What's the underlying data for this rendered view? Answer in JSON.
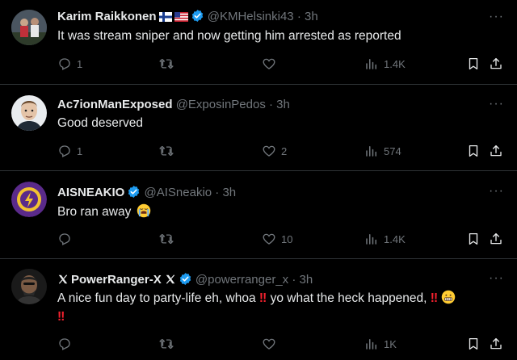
{
  "colors": {
    "background": "#000000",
    "text": "#e7e9ea",
    "muted": "#71767b",
    "verified": "#1d9bf0",
    "divider": "#2f3336"
  },
  "tweets": [
    {
      "name": "Karim Raikkonen",
      "flags": [
        "Finland flag",
        "USA flag"
      ],
      "verified": true,
      "handle": "@KMHelsinki43",
      "time": "3h",
      "text": "It was stream sniper and now getting him arrested as reported",
      "replies": "1",
      "retweets": "",
      "likes": "",
      "views": "1.4K",
      "more": "···"
    },
    {
      "name": "Ac7ionManExposed",
      "verified": false,
      "handle": "@ExposinPedos",
      "time": "3h",
      "text": "Good deserved",
      "replies": "1",
      "retweets": "",
      "likes": "2",
      "views": "574",
      "more": "···"
    },
    {
      "name": "AISNEAKIO",
      "verified": true,
      "handle": "@AISneakio",
      "time": "3h",
      "text": "Bro ran away",
      "text_emoji": "loudly-crying-face-emoji",
      "replies": "",
      "retweets": "",
      "likes": "10",
      "views": "1.4K",
      "more": "···"
    },
    {
      "name": "PowerRanger-X",
      "verified": true,
      "handle": "@powerranger_x",
      "time": "3h",
      "text_part1": "A nice fun day to party-life eh, whoa",
      "text_part2": "yo what the heck happened,",
      "bang": "‼",
      "replies": "",
      "retweets": "",
      "likes": "",
      "views": "1K",
      "more": "···"
    }
  ],
  "sep": "·"
}
